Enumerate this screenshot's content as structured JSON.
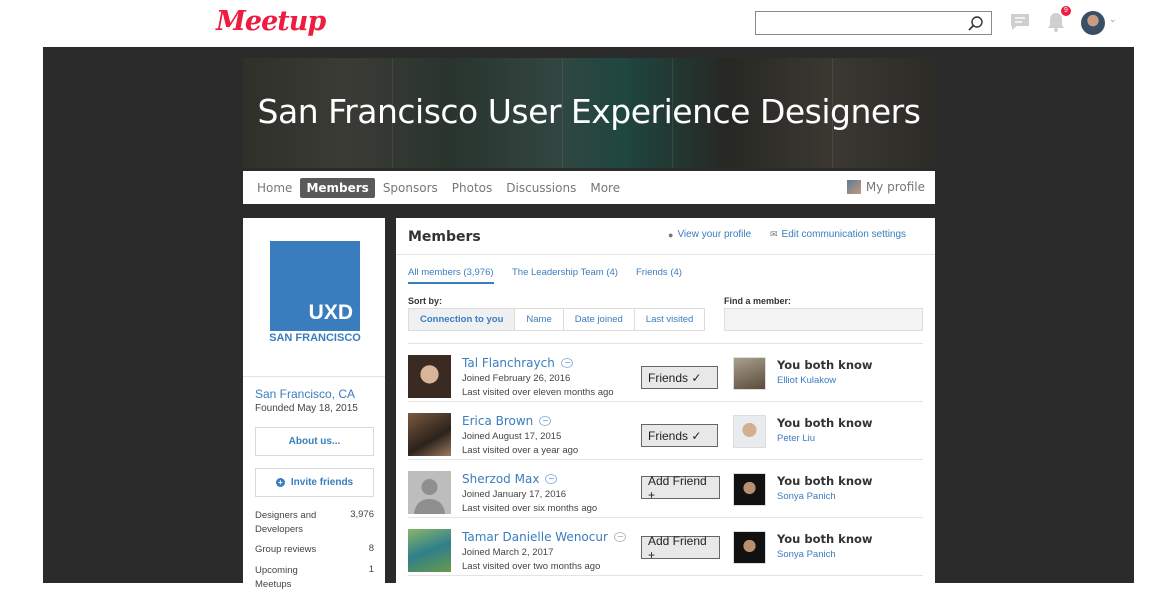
{
  "header": {
    "logo": "Meetup",
    "search": {
      "value": "",
      "placeholder": ""
    },
    "notification_count": "9",
    "icons": {
      "search": "search-icon",
      "messages": "chat-icon",
      "notifications": "bell-icon"
    }
  },
  "group": {
    "title": "San Francisco User Experience Designers",
    "nav": [
      "Home",
      "Members",
      "Sponsors",
      "Photos",
      "Discussions",
      "More"
    ],
    "active_nav": "Members",
    "my_profile": "My profile"
  },
  "sidebar": {
    "logo_text": "UXD",
    "logo_sub": "SAN FRANCISCO",
    "location": "San Francisco, CA",
    "founded": "Founded May 18, 2015",
    "about_button": "About us...",
    "invite_button": "Invite friends",
    "stats": [
      {
        "label": "Designers and Developers",
        "value": "3,976"
      },
      {
        "label": "Group reviews",
        "value": "8"
      },
      {
        "label": "Upcoming Meetups",
        "value": "1"
      }
    ]
  },
  "members": {
    "title": "Members",
    "view_profile": "View your profile",
    "edit_comm": "Edit communication settings",
    "tabs": [
      "All members (3,976)",
      "The Leadership Team (4)",
      "Friends (4)"
    ],
    "sort_label": "Sort by:",
    "sort_options": [
      "Connection to you",
      "Name",
      "Date joined",
      "Last visited"
    ],
    "find_label": "Find a member:",
    "find_placeholder": "",
    "rows": [
      {
        "name": "Tal Flanchraych",
        "joined": "Joined February 26, 2016",
        "visited": "Last visited over eleven months ago",
        "button": "Friends ✓",
        "know": "You both know",
        "mutual": "Elliot Kulakow"
      },
      {
        "name": "Erica Brown",
        "joined": "Joined August 17, 2015",
        "visited": "Last visited over a year ago",
        "button": "Friends ✓",
        "know": "You both know",
        "mutual": "Peter Liu"
      },
      {
        "name": "Sherzod Max",
        "joined": "Joined January 17, 2016",
        "visited": "Last visited over six months ago",
        "button": "Add Friend +",
        "know": "You both know",
        "mutual": "Sonya Panich"
      },
      {
        "name": "Tamar Danielle Wenocur",
        "joined": "Joined March 2, 2017",
        "visited": "Last visited over two months ago",
        "button": "Add Friend +",
        "know": "You both know",
        "mutual": "Sonya Panich"
      }
    ]
  },
  "colors": {
    "brand": "#ed1c40",
    "link": "#3a7dbf",
    "uxd_blue": "#3a7dbf",
    "dark_bg": "#2b2b2b"
  }
}
